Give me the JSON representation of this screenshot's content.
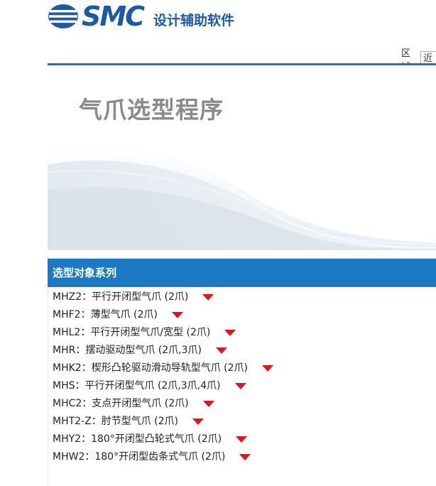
{
  "header": {
    "brand": "SMC",
    "app_title": "设计辅助软件",
    "region_label": "区域:",
    "region_value": "近"
  },
  "banner": {
    "title": "气爪选型程序"
  },
  "series_panel": {
    "title": "选型对象系列",
    "items": [
      {
        "label": "MHZ2：平行开闭型气爪 (2爪)"
      },
      {
        "label": "MHF2：薄型气爪 (2爪)"
      },
      {
        "label": "MHL2：平行开闭型气爪/宽型 (2爪)"
      },
      {
        "label": "MHR：摆动驱动型气爪 (2爪,3爪)"
      },
      {
        "label": "MHK2：楔形凸轮驱动滑动导轨型气爪 (2爪)"
      },
      {
        "label": "MHS：平行开闭型气爪 (2爪,3爪,4爪)"
      },
      {
        "label": "MHC2：支点开闭型气爪 (2爪)"
      },
      {
        "label": "MHT2-Z：肘节型气爪 (2爪)"
      },
      {
        "label": "MHY2：180°开闭型凸轮式气爪 (2爪)"
      },
      {
        "label": "MHW2：180°开闭型齿条式气爪 (2爪)"
      }
    ]
  },
  "colors": {
    "brand_blue": "#1c5aa6",
    "panel_blue": "#1b7ac3",
    "caret_red": "#e4121e"
  },
  "icons": {
    "logo": "smc-logo-icon",
    "expand": "caret-down-icon"
  }
}
